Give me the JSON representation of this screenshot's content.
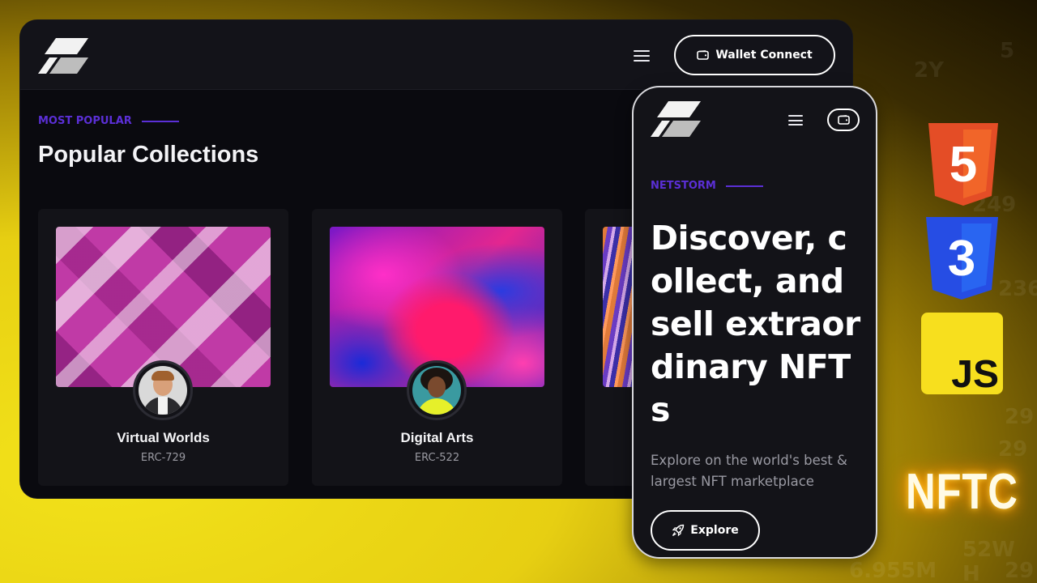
{
  "background": {
    "numbers": [
      "2Y",
      "5",
      "249",
      "236",
      "29",
      "29",
      "6.955M",
      "52W H",
      "29"
    ]
  },
  "desktop": {
    "header": {
      "logo_icon": "netstorm-logo-icon",
      "menu_icon": "hamburger-icon",
      "wallet_button_label": "Wallet Connect",
      "wallet_icon": "wallet-icon"
    },
    "section": {
      "eyebrow": "MOST POPULAR",
      "title": "Popular Collections"
    },
    "cards": [
      {
        "name": "Virtual Worlds",
        "standard": "ERC-729"
      },
      {
        "name": "Digital Arts",
        "standard": "ERC-522"
      }
    ]
  },
  "mobile": {
    "header": {
      "logo_icon": "netstorm-logo-icon",
      "menu_icon": "hamburger-icon",
      "wallet_icon": "wallet-icon"
    },
    "eyebrow": "NETSTORM",
    "hero_title": "Discover, collect, and sell extraordinary NFTs",
    "hero_subtitle": "Explore on the world's best & largest NFT marketplace",
    "explore_button_label": "Explore",
    "explore_icon": "rocket-icon"
  },
  "tech_badges": {
    "html": "5",
    "css": "3",
    "js": "JS"
  },
  "brand_text": "NFTC",
  "colors": {
    "accent": "#5b2fd6",
    "background_yellow": "#e7cf12",
    "panel": "#131318",
    "html5": "#e44d26",
    "css3": "#264de4",
    "js": "#f7df1e"
  }
}
